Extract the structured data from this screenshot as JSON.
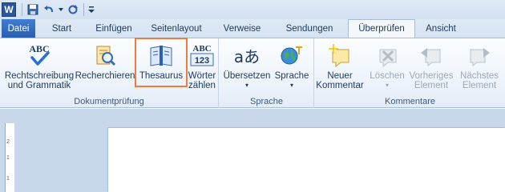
{
  "qat": {
    "logo_letter": "W",
    "save_icon": "save-icon",
    "undo_icon": "undo-icon",
    "redo_icon": "redo-icon",
    "customize_icon": "customize-qat-icon"
  },
  "tabs": [
    {
      "label": "Datei"
    },
    {
      "label": "Start"
    },
    {
      "label": "Einfügen"
    },
    {
      "label": "Seitenlayout"
    },
    {
      "label": "Verweise"
    },
    {
      "label": "Sendungen"
    },
    {
      "label": "Überprüfen"
    },
    {
      "label": "Ansicht"
    }
  ],
  "ribbon": {
    "groups": [
      {
        "label": "Dokumentprüfung",
        "buttons": [
          {
            "line1": "Rechtschreibung",
            "line2": "und Grammatik",
            "icon": "spelling-icon",
            "icon_text": "ABC"
          },
          {
            "line1": "Recherchieren",
            "line2": "",
            "icon": "research-icon"
          },
          {
            "line1": "Thesaurus",
            "line2": "",
            "icon": "thesaurus-icon"
          },
          {
            "line1": "Wörter",
            "line2": "zählen",
            "icon": "word-count-icon",
            "icon_text1": "ABC",
            "icon_text2": "123"
          }
        ]
      },
      {
        "label": "Sprache",
        "buttons": [
          {
            "line1": "Übersetzen",
            "line2": "▾",
            "icon": "translate-icon",
            "icon_text": "aあ"
          },
          {
            "line1": "Sprache",
            "line2": "▾",
            "icon": "language-icon"
          }
        ]
      },
      {
        "label": "Kommentare",
        "buttons": [
          {
            "line1": "Neuer",
            "line2": "Kommentar",
            "icon": "new-comment-icon"
          },
          {
            "line1": "Löschen",
            "line2": "▾",
            "icon": "delete-comment-icon"
          },
          {
            "line1": "Vorheriges",
            "line2": "Element",
            "icon": "previous-comment-icon"
          },
          {
            "line1": "Nächstes",
            "line2": "Element",
            "icon": "next-comment-icon"
          }
        ]
      }
    ]
  },
  "ruler": {
    "marks": [
      "2",
      "1",
      "1"
    ]
  },
  "colors": {
    "highlight": "#f07b3f",
    "file_tab": "#2a5fb0"
  }
}
